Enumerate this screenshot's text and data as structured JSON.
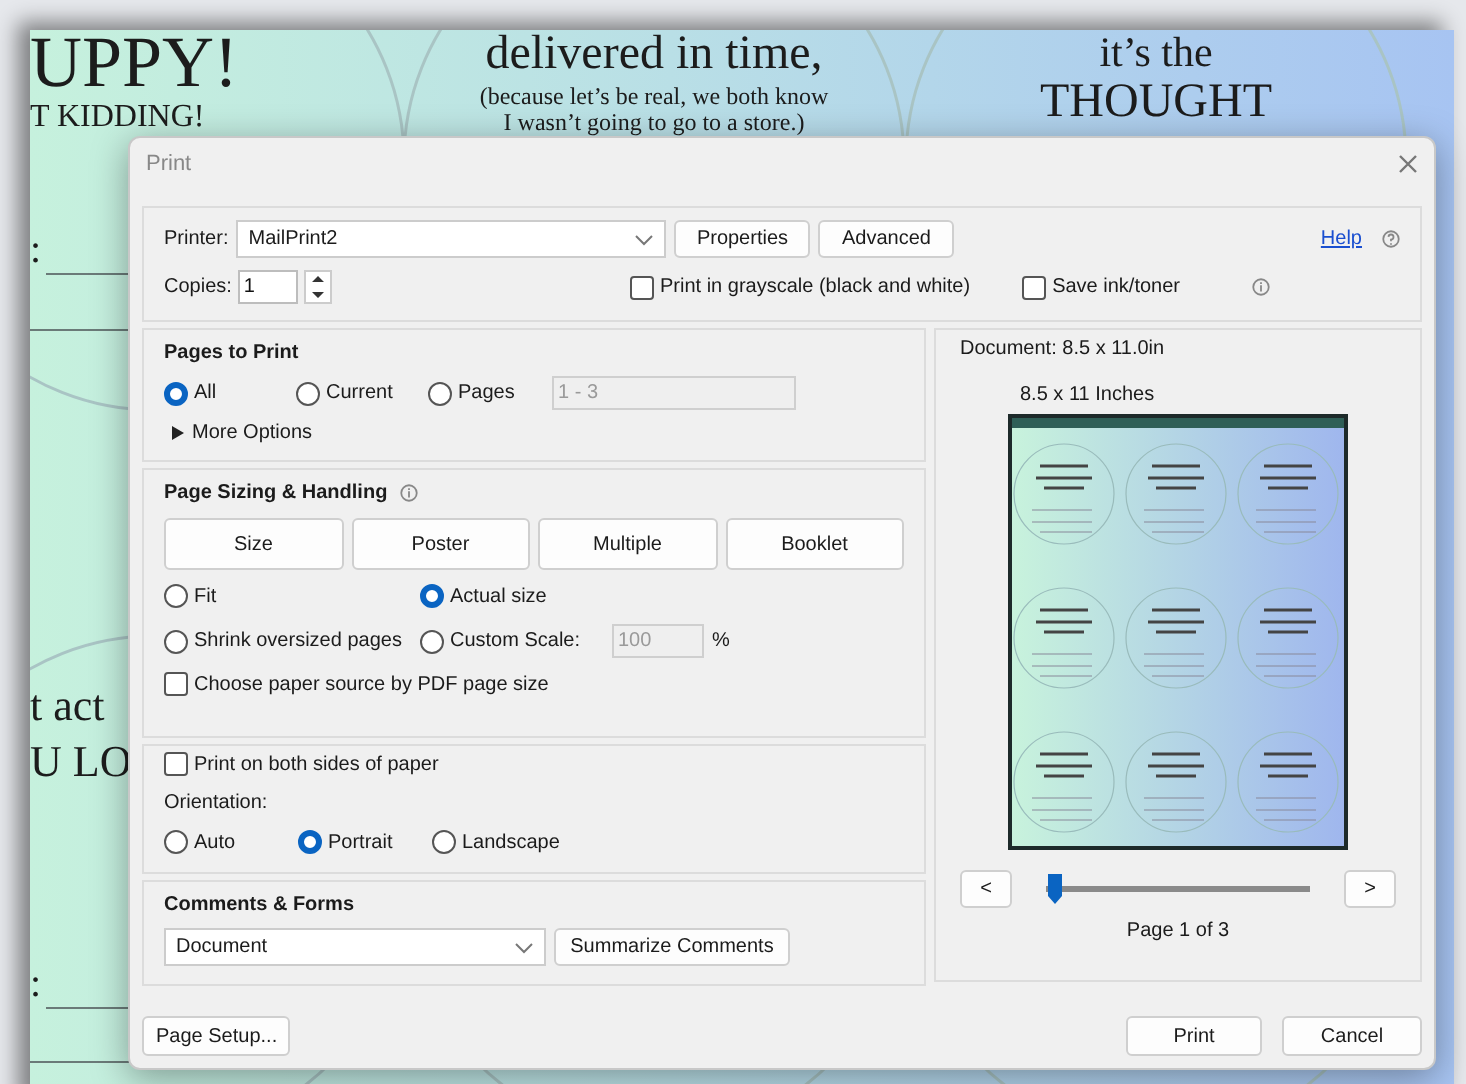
{
  "background": {
    "texts": [
      "UPPY!",
      "T KIDDING!",
      "delivered in time,",
      "(because let’s be real, we both know",
      "I wasn’t going to go to a store.)",
      "it’s the",
      "THOUGHT",
      ":",
      "t act",
      "U LO",
      ":"
    ]
  },
  "dialog": {
    "title": "Print",
    "printer": {
      "label": "Printer:",
      "value": "MailPrint2"
    },
    "properties_button": "Properties",
    "advanced_button": "Advanced",
    "help_link": "Help",
    "copies": {
      "label": "Copies:",
      "value": "1"
    },
    "grayscale": {
      "label": "Print in grayscale (black and white)",
      "checked": false
    },
    "save_ink": {
      "label": "Save ink/toner",
      "checked": false
    },
    "pages_to_print": {
      "title": "Pages to Print",
      "options": [
        {
          "label": "All",
          "selected": true
        },
        {
          "label": "Current",
          "selected": false
        },
        {
          "label": "Pages",
          "selected": false
        }
      ],
      "pages_value": "1 - 3",
      "more_options": "More Options"
    },
    "page_sizing": {
      "title": "Page Sizing & Handling",
      "tabs": [
        {
          "label": "Size",
          "selected": false
        },
        {
          "label": "Poster",
          "selected": false
        },
        {
          "label": "Multiple",
          "selected": false
        },
        {
          "label": "Booklet",
          "selected": false
        }
      ],
      "options": [
        {
          "label": "Fit",
          "selected": false
        },
        {
          "label": "Actual size",
          "selected": true
        },
        {
          "label": "Shrink oversized pages",
          "selected": false
        },
        {
          "label": "Custom Scale:",
          "selected": false
        }
      ],
      "scale_value": "100",
      "scale_unit": "%",
      "paper_source": {
        "label": "Choose paper source by PDF page size",
        "checked": false
      }
    },
    "duplex": {
      "label": "Print on both sides of paper",
      "checked": false
    },
    "orientation": {
      "label": "Orientation:",
      "options": [
        {
          "label": "Auto",
          "selected": false
        },
        {
          "label": "Portrait",
          "selected": true
        },
        {
          "label": "Landscape",
          "selected": false
        }
      ]
    },
    "comments": {
      "title": "Comments & Forms",
      "value": "Document",
      "button": "Summarize Comments"
    },
    "preview": {
      "document": "Document: 8.5 x 11.0in",
      "size": "8.5 x 11 Inches",
      "prev": "<",
      "next": ">",
      "level": 0,
      "page": "Page 1 of 3"
    },
    "page_setup_button": "Page Setup...",
    "print_button": "Print",
    "cancel_button": "Cancel"
  }
}
